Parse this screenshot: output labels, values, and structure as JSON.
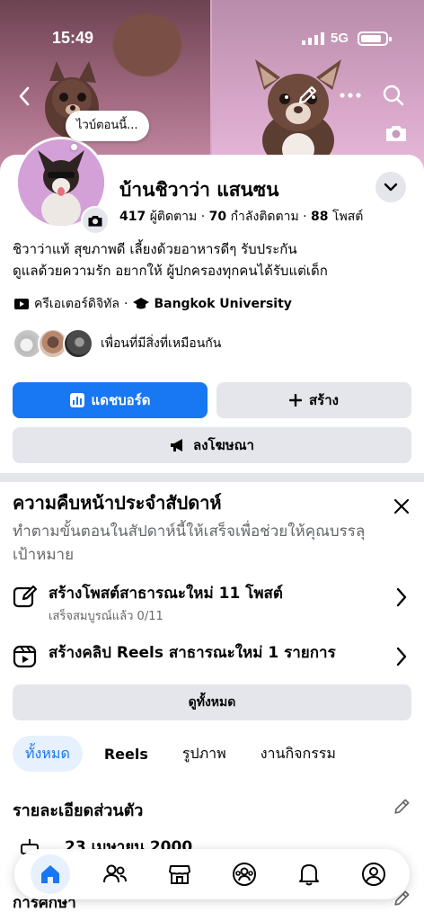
{
  "status_bar": {
    "time": "15:49",
    "network": "5G"
  },
  "cover": {
    "avatar_bubble_text": "ไวบ์ตอนนี้..."
  },
  "profile": {
    "name": "บ้านชิวาว่า แสนซน",
    "followers_count": "417",
    "followers_label": "ผู้ติดตาม",
    "following_count": "70",
    "following_label": "กำลังติดตาม",
    "posts_count": "88",
    "posts_label": "โพสต์",
    "bio_line1": "ชิวาว่าแท้ สุขภาพดี เลี้ยงด้วยอาหารดีๆ รับประกัน",
    "bio_line2": "ดูแลด้วยความรัก อยากให้ ผู้ปกครองทุกคนได้รับแต่เด็ก",
    "category": "ครีเอเตอร์ดิจิทัล",
    "university": "Bangkok University",
    "mutual_text": "เพื่อนที่มีสิ่งที่เหมือนกัน"
  },
  "actions": {
    "dashboard_label": "แดชบอร์ด",
    "create_label": "สร้าง",
    "advertise_label": "ลงโฆษณา"
  },
  "weekly": {
    "title": "ความคืบหน้าประจำสัปดาห์",
    "subtitle": "ทำตามขั้นตอนในสัปดาห์นี้ให้เสร็จเพื่อช่วยให้คุณบรรลุเป้าหมาย",
    "tasks": [
      {
        "title": "สร้างโพสต์สาธารณะใหม่ 11 โพสต์",
        "sub": "เสร็จสมบูรณ์แล้ว 0/11",
        "icon": "edit-icon"
      },
      {
        "title": "สร้างคลิป Reels สาธารณะใหม่ 1 รายการ",
        "sub": "",
        "icon": "reels-icon"
      }
    ],
    "see_all_label": "ดูทั้งหมด"
  },
  "tabs": [
    {
      "label": "ทั้งหมด",
      "active": true
    },
    {
      "label": "Reels",
      "active": false
    },
    {
      "label": "รูปภาพ",
      "active": false
    },
    {
      "label": "งานกิจกรรม",
      "active": false
    }
  ],
  "details": {
    "title": "รายละเอียดส่วนตัว",
    "birthday_partial": "23 เมษายน 2000",
    "education_partial": "การศึกษา"
  },
  "bottom_nav": [
    {
      "icon": "home-icon",
      "active": true
    },
    {
      "icon": "friends-icon",
      "active": false
    },
    {
      "icon": "marketplace-icon",
      "active": false
    },
    {
      "icon": "groups-icon",
      "active": false
    },
    {
      "icon": "notifications-icon",
      "active": false
    },
    {
      "icon": "profile-icon",
      "active": false
    }
  ],
  "colors": {
    "accent": "#1877f2",
    "gray_button": "#e4e6eb",
    "secondary_text": "#65676b"
  }
}
